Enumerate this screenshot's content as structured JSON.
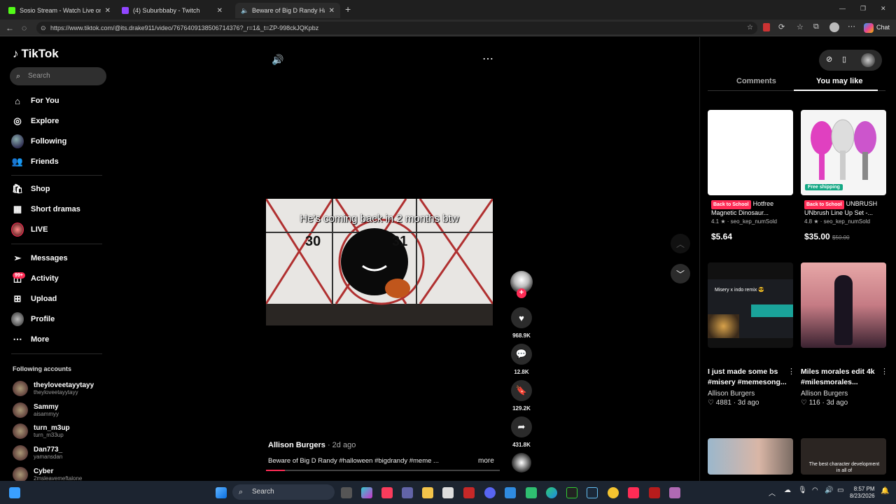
{
  "browser": {
    "tabs": [
      {
        "title": "Sosio Stream - Watch Live on Kick",
        "close": "✕"
      },
      {
        "title": "(4) Suburbbaby - Twitch",
        "close": "✕"
      },
      {
        "title": "Beware of Big D Randy Hallow",
        "close": "✕"
      }
    ],
    "new_tab": "+",
    "url": "https://www.tiktok.com/@its.drake911/video/7676409138506714376?_r=1&_t=ZP-998ckJQKpbz",
    "chat_label": "Chat",
    "window_controls": {
      "minimize": "—",
      "restore": "❐",
      "close": "✕"
    }
  },
  "sidebar": {
    "logo": "TikTok",
    "search_placeholder": "Search",
    "nav": [
      {
        "label": "For You",
        "icon": "home-icon"
      },
      {
        "label": "Explore",
        "icon": "compass-icon"
      },
      {
        "label": "Following",
        "icon": "following-avatar"
      },
      {
        "label": "Friends",
        "icon": "friends-icon"
      },
      {
        "label": "Shop",
        "icon": "shop-bag-icon"
      },
      {
        "label": "Short dramas",
        "icon": "short-dramas-icon"
      },
      {
        "label": "LIVE",
        "icon": "live-icon"
      },
      {
        "label": "Messages",
        "icon": "messages-icon"
      },
      {
        "label": "Activity",
        "icon": "activity-icon"
      },
      {
        "label": "Upload",
        "icon": "upload-icon"
      },
      {
        "label": "Profile",
        "icon": "profile-avatar"
      },
      {
        "label": "More",
        "icon": "more-icon"
      }
    ],
    "activity_badge": "99+",
    "following_title": "Following accounts",
    "following": [
      {
        "name": "theyloveetayytayy",
        "handle": "theyloveetayytayy"
      },
      {
        "name": "Sammy",
        "handle": "aisammyy"
      },
      {
        "name": "turn_m3up",
        "handle": "turn_m33up"
      },
      {
        "name": "Dan773_",
        "handle": "yamansdan"
      },
      {
        "name": "Cyber",
        "handle": "2msleavemeftalone"
      }
    ]
  },
  "video": {
    "caption": "He's coming back in 2 months btw",
    "author": "Allison Burgers",
    "ago": " · 2d ago",
    "description": "Beware of Big D Randy #halloween #bigdrandy #meme ...",
    "more": "more",
    "progress": 0.08,
    "calendar_numbers": [
      "30",
      "31"
    ],
    "actions": [
      {
        "name": "like",
        "icon": "heart-icon",
        "count": "968.9K"
      },
      {
        "name": "comment",
        "icon": "comment-icon",
        "count": "12.8K"
      },
      {
        "name": "save",
        "icon": "bookmark-icon",
        "count": "129.2K"
      },
      {
        "name": "share",
        "icon": "share-icon",
        "count": "431.8K"
      }
    ],
    "follow_plus": "+"
  },
  "right_panel": {
    "tabs": {
      "comments": "Comments",
      "you_may_like": "You may like"
    },
    "products": [
      {
        "tag": "Back to School",
        "title": "Hotfree Magnetic Dinosaur...",
        "rating": "4.1 ★ · seo_kep_numSold",
        "price": "$5.64",
        "old_price": ""
      },
      {
        "tag": "Back to School",
        "title": "UNBRUSH UNbrush Line Up Set -...",
        "rating": "4.8 ★ · seo_kep_numSold",
        "price": "$35.00",
        "old_price": "$50.00",
        "badge": "Free shipping"
      }
    ],
    "videos": [
      {
        "title": "I just made some bs #misery #memesong...",
        "author": "Allison Burgers",
        "stats": "♡ 4881 · 3d ago",
        "thumb_text": "Misery x indo remix 😎"
      },
      {
        "title": "Miles morales edit 4k #milesmorales...",
        "author": "Allison Burgers",
        "stats": "♡ 116 · 3d ago"
      }
    ],
    "bottom_thumb_text": "The best character development in all of"
  },
  "taskbar": {
    "search_label": "Search",
    "time": "8:57 PM",
    "date": "8/23/2026"
  },
  "colors": {
    "accent": "#fe2c55",
    "free_shipping": "#13a884"
  }
}
